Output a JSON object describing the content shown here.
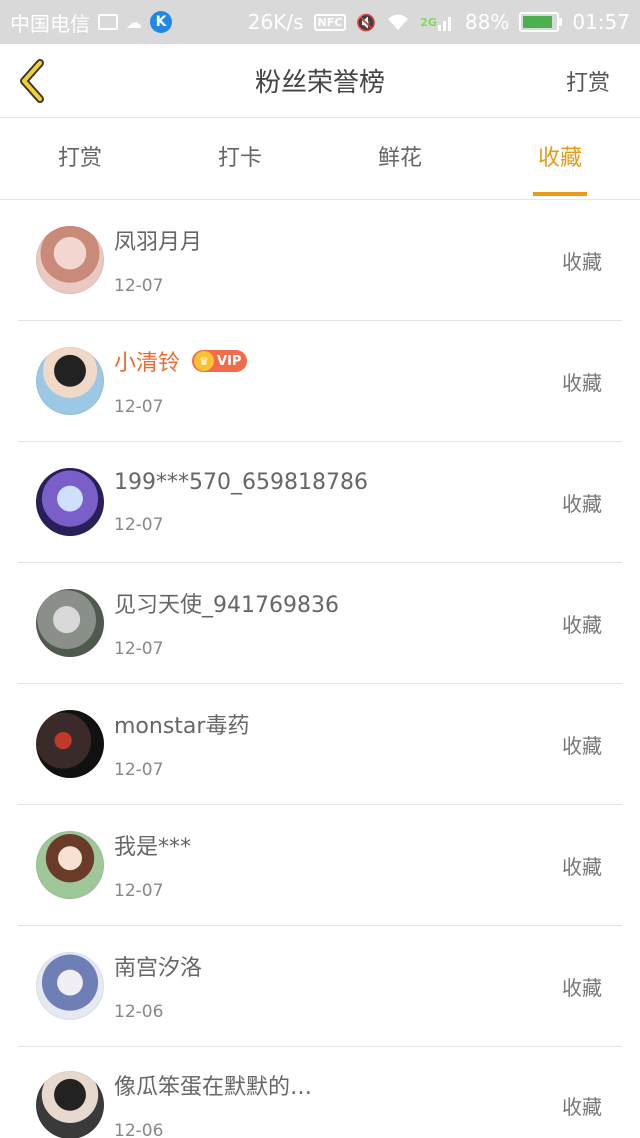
{
  "status_bar": {
    "carrier": "中国电信",
    "speed": "26K/s",
    "nfc": "NFC",
    "network": "2G",
    "battery": "88%",
    "time": "01:57",
    "battery_level": 0.88
  },
  "header": {
    "title": "粉丝荣誉榜",
    "action": "打赏"
  },
  "tabs": [
    {
      "label": "打赏"
    },
    {
      "label": "打卡"
    },
    {
      "label": "鲜花"
    },
    {
      "label": "收藏"
    }
  ],
  "active_tab": "收藏",
  "colors": {
    "accent": "#e69a1e",
    "vip_name": "#f06a2e"
  },
  "list": [
    {
      "name": "凤羽月月",
      "date": "12-07",
      "action": "收藏",
      "vip": ""
    },
    {
      "name": "小清铃",
      "date": "12-07",
      "action": "收藏",
      "vip": "VIP"
    },
    {
      "name": "199***570_659818786",
      "date": "12-07",
      "action": "收藏",
      "vip": ""
    },
    {
      "name": "见习天使_941769836",
      "date": "12-07",
      "action": "收藏",
      "vip": ""
    },
    {
      "name": "monstar毒药",
      "date": "12-07",
      "action": "收藏",
      "vip": ""
    },
    {
      "name": "我是***",
      "date": "12-07",
      "action": "收藏",
      "vip": ""
    },
    {
      "name": "南宫汐洛",
      "date": "12-06",
      "action": "收藏",
      "vip": ""
    },
    {
      "name": "像瓜笨蛋在默默的…",
      "date": "12-06",
      "action": "收藏",
      "vip": ""
    }
  ]
}
